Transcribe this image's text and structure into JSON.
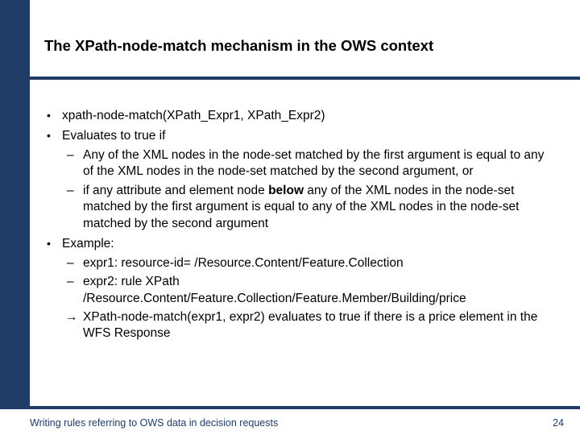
{
  "slide": {
    "title": "The XPath-node-match mechanism in the OWS context",
    "bullets": [
      {
        "text": "xpath-node-match(XPath_Expr1, XPath_Expr2)"
      },
      {
        "text": "Evaluates to true if",
        "sub": [
          {
            "text": "Any of the XML nodes in the node-set matched by the first argument is equal to any of the XML nodes in the node-set matched by the second argument, or"
          },
          {
            "text_pre": "if any attribute and element node ",
            "bold": "below",
            "text_post": " any of the XML nodes in the node-set matched by the first argument is equal to any of the XML nodes in the node-set matched by the second argument"
          }
        ]
      },
      {
        "text": "Example:",
        "sub": [
          {
            "text": "expr1: resource-id= /Resource.Content/Feature.Collection"
          },
          {
            "text": "expr2: rule XPath /Resource.Content/Feature.Collection/Feature.Member/Building/price"
          },
          {
            "arrow": true,
            "text": "XPath-node-match(expr1, expr2) evaluates to true if there is a price element in the WFS Response"
          }
        ]
      }
    ],
    "footer": {
      "text": "Writing rules referring to OWS data in decision requests",
      "page": "24"
    }
  }
}
